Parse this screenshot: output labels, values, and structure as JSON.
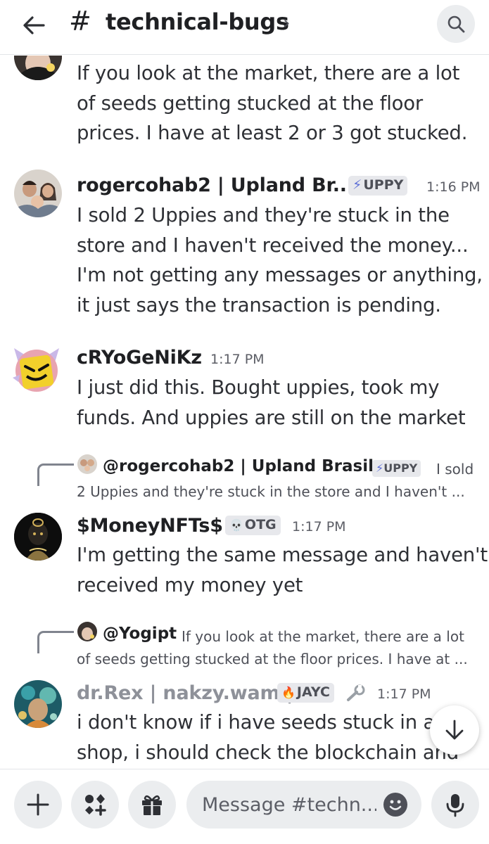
{
  "header": {
    "hash": "#",
    "channel": "technical-bugs",
    "chevron": "›"
  },
  "messages": [
    {
      "lines": [
        "If you look at the market, there are a lot",
        "of seeds getting stucked at the floor",
        "prices. I have at least 2 or 3 got stucked."
      ]
    },
    {
      "username": "rogercohab2 | Upland Br...",
      "tag": "UPPY",
      "tag_icon": "⚡",
      "time": "1:16 PM",
      "lines": [
        "I sold 2 Uppies and they're stuck in the",
        "store and I haven't received the money...",
        "I'm not getting any messages or anything,",
        "it just says the transaction is pending."
      ]
    },
    {
      "username": "cRYoGeNiKz",
      "time": "1:17 PM",
      "lines": [
        "I just did this. Bought uppies, took my",
        "funds. And uppies are still on the market"
      ]
    },
    {
      "reply": {
        "name": "@rogercohab2 | Upland Brasil",
        "tag": "UPPY",
        "tag_icon": "⚡",
        "snippet_1": "I sold",
        "snippet_2": "2 Uppies and they're stuck in the store and I haven't ..."
      },
      "username": "$MoneyNFTs$",
      "tag": "OTG",
      "tag_icon": "💀",
      "time": "1:17 PM",
      "lines": [
        "I'm getting the same message and haven't",
        "received my money yet"
      ]
    },
    {
      "reply": {
        "name": "@Yogipt",
        "snippet_1": "If you look at the market, there are a lot",
        "snippet_2": "of seeds getting stucked at the floor prices. I have at ..."
      },
      "username": "dr.Rex | nakzy.wam |",
      "tag": "JAYC",
      "tag_icon": "🔥",
      "extra_icon": "wrench-icon",
      "time": "1:17 PM",
      "lines": [
        "i don't know if i have seeds stuck in a",
        "shop, i should check the blockchain and"
      ]
    }
  ],
  "composer": {
    "placeholder": "Message #techn..."
  },
  "colors": {
    "text": "#2e3035",
    "muted": "#5c5e66",
    "tag_bg": "#e7e8ec",
    "bar_bg": "#ebedef",
    "username_faded": "#8e9199"
  }
}
